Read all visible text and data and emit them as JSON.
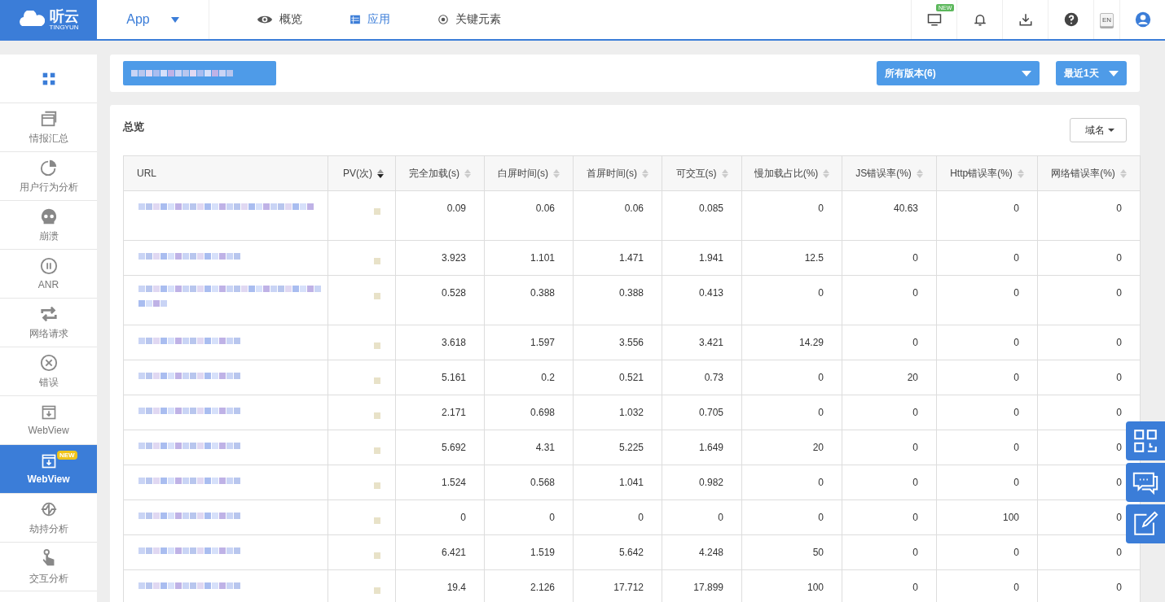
{
  "header": {
    "logo": "听云",
    "logo_sub": "TINGYUN",
    "app_menu": "App",
    "nav": [
      {
        "label": "概览",
        "selected": false
      },
      {
        "label": "应用",
        "selected": true
      },
      {
        "label": "关键元素",
        "selected": false
      }
    ],
    "monitor_badge": "NEW",
    "language": "EN"
  },
  "sidebar": {
    "items": [
      {
        "selected": false
      },
      {
        "label": "情报汇总",
        "selected": false
      },
      {
        "label": "用户行为分析",
        "selected": false
      },
      {
        "label": "崩溃",
        "selected": false
      },
      {
        "label": "ANR",
        "selected": false
      },
      {
        "label": "网络请求",
        "selected": false
      },
      {
        "label": "错误",
        "selected": false
      },
      {
        "label": "WebView",
        "selected": false
      },
      {
        "label": "WebView",
        "selected": true,
        "badge": "NEW"
      },
      {
        "label": "劫持分析",
        "selected": false
      },
      {
        "label": "交互分析",
        "selected": false
      }
    ]
  },
  "filters": {
    "version": "所有版本(6)",
    "period": "最近1天"
  },
  "overview": {
    "title": "总览",
    "domain_button": "域名",
    "columns": [
      {
        "label": "URL",
        "sortable": false
      },
      {
        "label": "PV(次)",
        "sortable": true,
        "sorted": true
      },
      {
        "label": "完全加载(s)",
        "sortable": true,
        "sorted": false
      },
      {
        "label": "白屏时间(s)",
        "sortable": true,
        "sorted": false
      },
      {
        "label": "首屏时间(s)",
        "sortable": true,
        "sorted": false
      },
      {
        "label": "可交互(s)",
        "sortable": true,
        "sorted": false
      },
      {
        "label": "慢加载占比(%)",
        "sortable": true,
        "sorted": false
      },
      {
        "label": "JS错误率(%)",
        "sortable": true,
        "sorted": false
      },
      {
        "label": "Http错误率(%)",
        "sortable": true,
        "sorted": false
      },
      {
        "label": "网络错误率(%)",
        "sortable": true,
        "sorted": false
      }
    ],
    "rows": [
      {
        "kind": "tall",
        "cells": [
          "",
          "",
          "0.09",
          "0.06",
          "0.06",
          "0.085",
          "0",
          "40.63",
          "0",
          "0"
        ]
      },
      {
        "kind": "normal",
        "cells": [
          "",
          "",
          "3.923",
          "1.101",
          "1.471",
          "1.941",
          "12.5",
          "0",
          "0",
          "0"
        ]
      },
      {
        "kind": "tall2",
        "cells": [
          "",
          "",
          "0.528",
          "0.388",
          "0.388",
          "0.413",
          "0",
          "0",
          "0",
          "0"
        ]
      },
      {
        "kind": "normal",
        "cells": [
          "",
          "",
          "3.618",
          "1.597",
          "3.556",
          "3.421",
          "14.29",
          "0",
          "0",
          "0"
        ]
      },
      {
        "kind": "normal",
        "cells": [
          "",
          "",
          "5.161",
          "0.2",
          "0.521",
          "0.73",
          "0",
          "20",
          "0",
          "0"
        ]
      },
      {
        "kind": "normal",
        "cells": [
          "",
          "",
          "2.171",
          "0.698",
          "1.032",
          "0.705",
          "0",
          "0",
          "0",
          "0"
        ]
      },
      {
        "kind": "normal",
        "cells": [
          "",
          "",
          "5.692",
          "4.31",
          "5.225",
          "1.649",
          "20",
          "0",
          "0",
          "0"
        ]
      },
      {
        "kind": "normal",
        "cells": [
          "",
          "",
          "1.524",
          "0.568",
          "1.041",
          "0.982",
          "0",
          "0",
          "0",
          "0"
        ]
      },
      {
        "kind": "normal",
        "cells": [
          "",
          "",
          "0",
          "0",
          "0",
          "0",
          "0",
          "0",
          "100",
          "0"
        ]
      },
      {
        "kind": "normal",
        "cells": [
          "",
          "",
          "6.421",
          "1.519",
          "5.642",
          "4.248",
          "50",
          "0",
          "0",
          "0"
        ]
      },
      {
        "kind": "normal",
        "cells": [
          "",
          "",
          "19.4",
          "2.126",
          "17.712",
          "17.899",
          "100",
          "0",
          "0",
          "0"
        ]
      }
    ]
  }
}
